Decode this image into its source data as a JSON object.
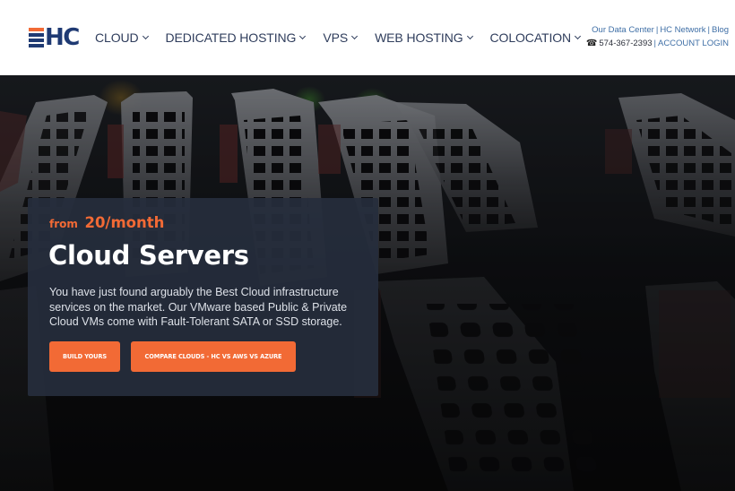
{
  "header": {
    "logo": {
      "text": "HC",
      "icon": "hc-logo-bars-icon"
    },
    "nav": [
      {
        "label": "CLOUD",
        "has_dropdown": true
      },
      {
        "label": "DEDICATED HOSTING",
        "has_dropdown": true
      },
      {
        "label": "VPS",
        "has_dropdown": true
      },
      {
        "label": "WEB HOSTING",
        "has_dropdown": true
      },
      {
        "label": "COLOCATION",
        "has_dropdown": true
      }
    ],
    "top_links": {
      "data_center": "Our Data Center",
      "hc_network": "HC Network",
      "blog": "Blog",
      "separator": "|",
      "phone_icon": "☎",
      "phone": "574-367-2393",
      "account_login": "ACCOUNT LOGIN"
    }
  },
  "hero": {
    "background": "server-rack-drive-bays-photo",
    "price_prefix": "from",
    "price": "20/month",
    "title": "Cloud Servers",
    "description": "You have just found arguably the Best Cloud infrastructure services on the market. Our VMware based Public & Private Cloud VMs come with Fault-Tolerant SATA or SSD storage.",
    "buttons": {
      "build": "BUILD YOURS",
      "compare": "COMPARE CLOUDS - HC VS AWS VS AZURE"
    }
  },
  "colors": {
    "brand_navy": "#1f3a73",
    "accent_orange": "#f26a35",
    "nav_text": "#2f3d5c",
    "link_blue": "#3f6fa6",
    "card_bg": "#262d3c"
  }
}
